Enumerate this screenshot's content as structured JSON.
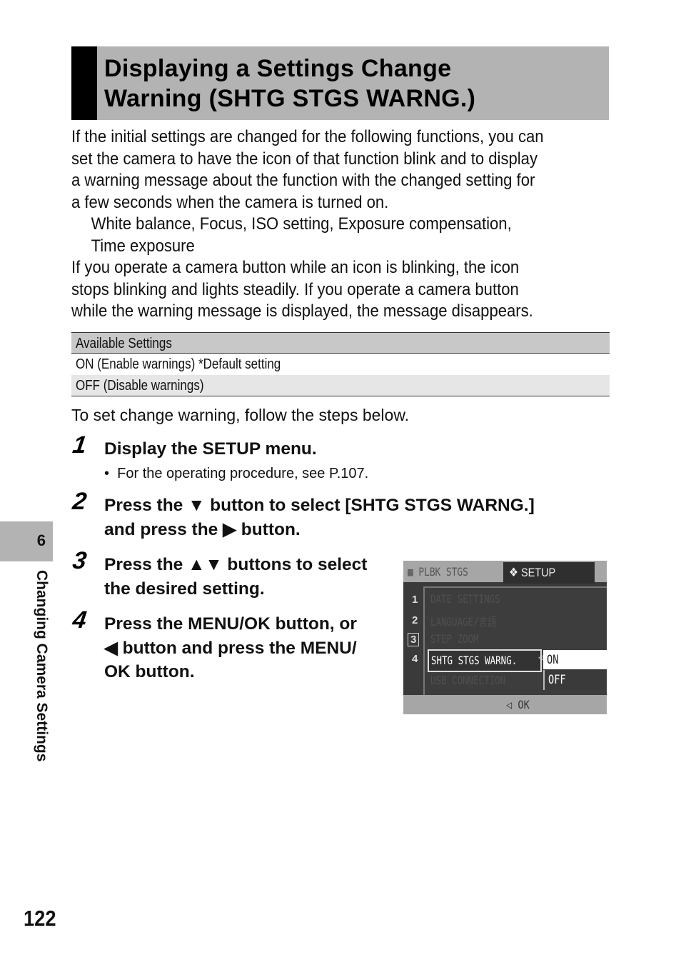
{
  "title": {
    "line1": "Displaying a Settings Change",
    "line2": "Warning (SHTG STGS WARNG.)"
  },
  "intro": {
    "lines": [
      "If the initial settings are changed for the following functions, you can",
      "set the camera to have the icon of that function blink and to display",
      "a warning message about the function with the changed setting for",
      "a few seconds when the camera is turned on."
    ],
    "functions_lines": [
      "White balance, Focus, ISO setting, Exposure compensation,",
      "Time exposure"
    ],
    "blink_lines": [
      "If you operate a camera button while an icon is blinking, the icon",
      "stops blinking and lights steadily. If you operate a camera button",
      "while the warning message is displayed, the message disappears."
    ]
  },
  "settings_table": {
    "header": "Available Settings",
    "rows": [
      "ON (Enable warnings) *Default setting",
      "OFF (Disable warnings)"
    ]
  },
  "lead": "To set change warning, follow the steps below.",
  "steps": [
    {
      "number": "1",
      "lines": [
        "Display the SETUP menu."
      ],
      "bullet": "For the operating procedure, see P.107."
    },
    {
      "number": "2",
      "lines": [
        "Press the ▼ button to select [SHTG STGS WARNG.]",
        "and press the ▶ button."
      ]
    },
    {
      "number": "3",
      "lines": [
        "Press the ▲▼ buttons to select",
        "the desired setting."
      ]
    },
    {
      "number": "4",
      "lines": [
        "Press the MENU/OK button, or",
        "◀ button and press the MENU/",
        "OK button."
      ]
    }
  ],
  "bullet_glyph": "•",
  "camera_screen": {
    "tab_inactive": "PLBK STGS",
    "tab_active": "SETUP",
    "tab_active_icon": "wrench-icon",
    "menu_numbers": [
      "1",
      "2",
      "3",
      "4"
    ],
    "menu_items": [
      "DATE SETTINGS",
      "LANGUAGE/言語",
      "STEP ZOOM",
      "SHTG STGS WARNG.",
      "USB CONNECTION"
    ],
    "selected_item": "SHTG STGS WARNG.",
    "options": [
      "ON",
      "OFF"
    ],
    "selected_option": "ON",
    "footer": "◁ OK"
  },
  "side": {
    "chapter_number": "6",
    "chapter_title": "Changing Camera Settings"
  },
  "page_number": "122"
}
